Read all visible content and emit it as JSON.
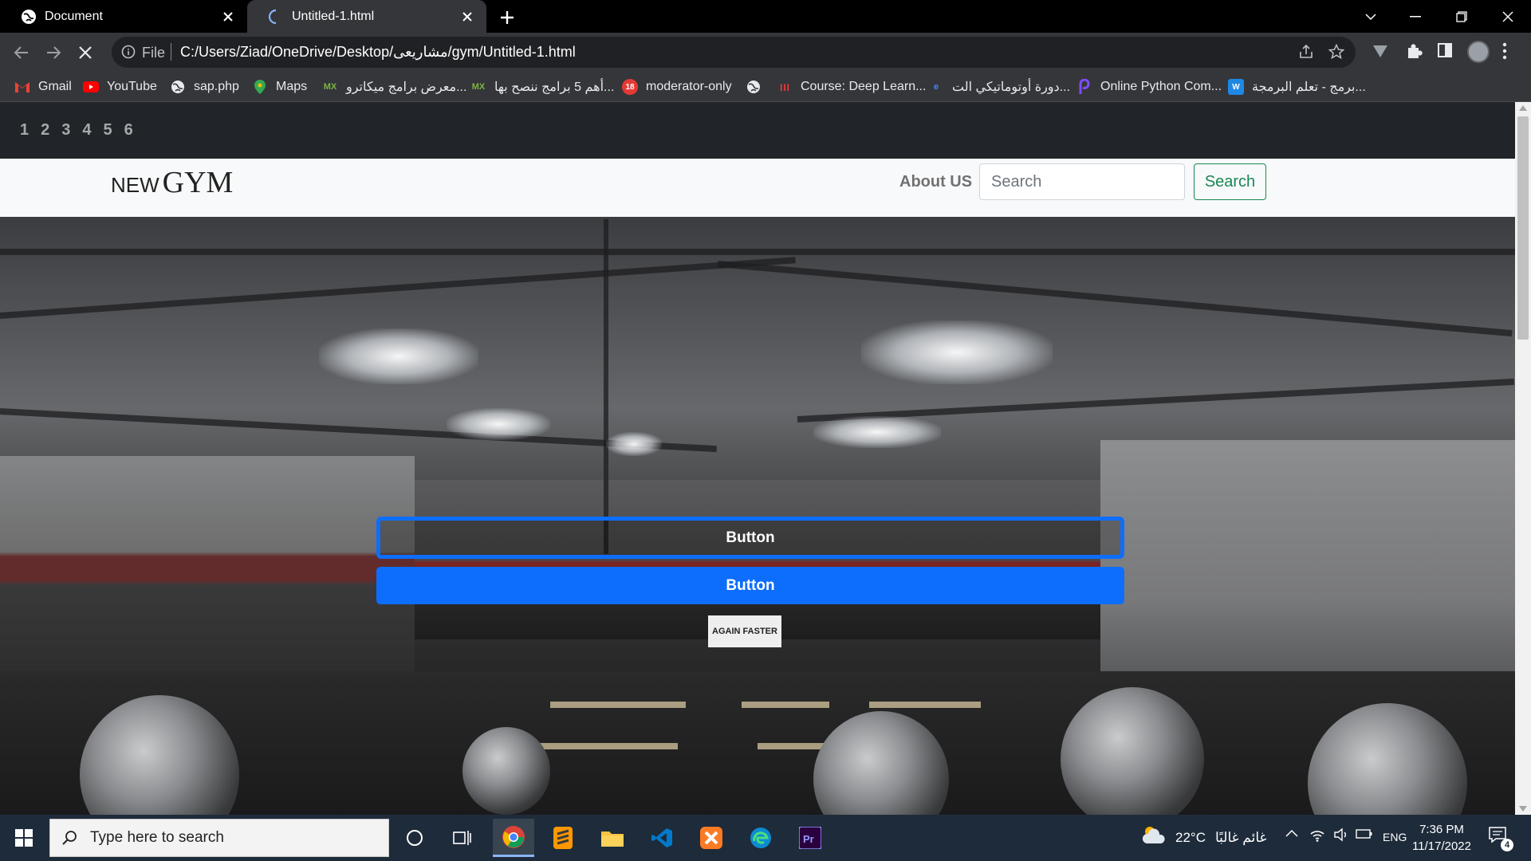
{
  "browser": {
    "tabs": [
      {
        "title": "Document",
        "active": false
      },
      {
        "title": "Untitled-1.html",
        "active": true
      }
    ],
    "address": {
      "scheme_label": "File",
      "url": "C:/Users/Ziad/OneDrive/Desktop/مشاريعى/gym/Untitled-1.html"
    },
    "bookmarks": [
      {
        "label": "Gmail",
        "icon": "gmail-icon",
        "color": "#ea4335"
      },
      {
        "label": "YouTube",
        "icon": "youtube-icon",
        "color": "#ff0000"
      },
      {
        "label": "sap.php",
        "icon": "globe-icon",
        "color": "#e8eaed"
      },
      {
        "label": "Maps",
        "icon": "maps-icon",
        "color": "#34a853"
      },
      {
        "label": "معرض برامج ميكاترو...",
        "icon": "mx-icon",
        "color": "#7cb342"
      },
      {
        "label": "أهم 5 برامج ننصح بها...",
        "icon": "mx-icon",
        "color": "#7cb342"
      },
      {
        "label": "moderator-only",
        "icon": "badge-icon",
        "color": "#e53935",
        "badge": "18"
      },
      {
        "label": "",
        "icon": "globe-icon",
        "color": "#e8eaed"
      },
      {
        "label": "Course: Deep Learn...",
        "icon": "course-icon",
        "color": "#e53935"
      },
      {
        "label": "دورة أوتوماتيكي الت...",
        "icon": "doc-icon",
        "color": "#4285f4"
      },
      {
        "label": "Online Python Com...",
        "icon": "python-icon",
        "color": "#7c4dff"
      },
      {
        "label": "برمج - تعلم البرمجة...",
        "icon": "code-icon",
        "color": "#1e88e5"
      }
    ]
  },
  "page": {
    "number_nav": [
      "1",
      "2",
      "3",
      "4",
      "5",
      "6"
    ],
    "brand": {
      "small": "NEW",
      "big": "GYM"
    },
    "about_link": "About US",
    "search": {
      "placeholder": "Search",
      "value": "",
      "button": "Search"
    },
    "hero": {
      "button_outline": "Button",
      "button_solid": "Button",
      "sign_text": "AGAIN FASTER"
    },
    "colors": {
      "primary": "#0d6efd",
      "success": "#198754",
      "dark_nav": "#212529"
    }
  },
  "taskbar": {
    "search_placeholder": "Type here to search",
    "weather": "22°C",
    "weather_desc": "غائم غالبًا",
    "language": "ENG",
    "time": "7:36 PM",
    "date": "11/17/2022",
    "notifications": "4"
  }
}
